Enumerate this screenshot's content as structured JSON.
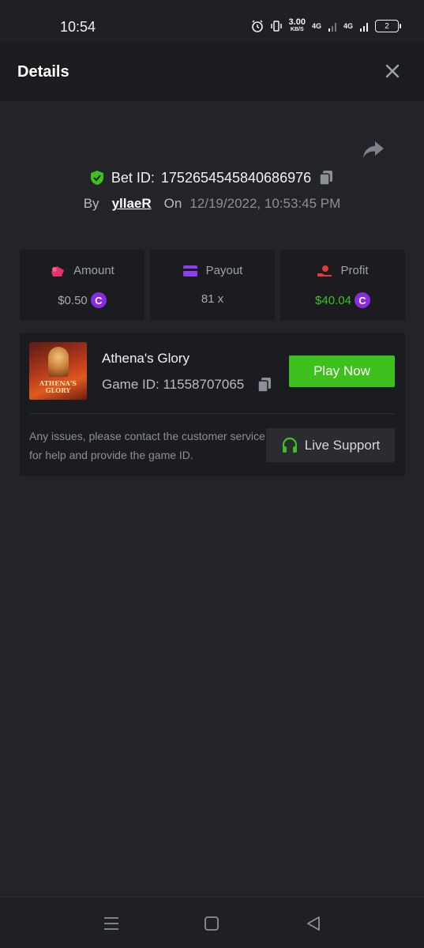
{
  "status_bar": {
    "time": "10:54",
    "net_speed_value": "3.00",
    "net_speed_unit": "KB/S",
    "signal_1": "4G",
    "signal_2": "4G",
    "battery": "2"
  },
  "header": {
    "title": "Details"
  },
  "bet": {
    "label": "Bet ID:",
    "id": "1752654545840686976",
    "by_label": "By",
    "user": "yllaeR",
    "on_label": "On",
    "date": "12/19/2022, 10:53:45 PM"
  },
  "stats": {
    "amount": {
      "label": "Amount",
      "value": "$0.50"
    },
    "payout": {
      "label": "Payout",
      "value": "81 x"
    },
    "profit": {
      "label": "Profit",
      "value": "$40.04"
    }
  },
  "game": {
    "thumb_text": "ATHENA'S GLORY",
    "name": "Athena's Glory",
    "id_label": "Game ID:",
    "id": "11558707065",
    "play_label": "Play Now",
    "support_text": "Any issues, please contact the customer service for help and provide the game ID.",
    "support_label": "Live Support"
  },
  "colors": {
    "accent_green": "#3ec11f",
    "coin_purple": "#8a2be2",
    "background": "#232427",
    "card": "#1b1c1f"
  }
}
